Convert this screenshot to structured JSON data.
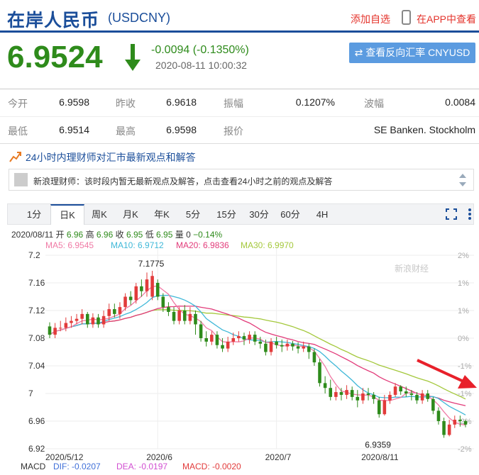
{
  "header": {
    "title": "在岸人民币",
    "code": "(USDCNY)",
    "add_favorite": "添加自选",
    "view_in_app": "在APP中查看"
  },
  "quote": {
    "price": "6.9524",
    "change": "-0.0094 (-0.1350%)",
    "time": "2020-08-11 10:00:32",
    "reverse_button": "查看反向汇率 CNYUSD",
    "price_color": "#2e8b1b",
    "rows": [
      [
        {
          "label": "今开",
          "value": "6.9598"
        },
        {
          "label": "昨收",
          "value": "6.9618"
        },
        {
          "label": "振幅",
          "value": "0.1207%"
        },
        {
          "label": "波幅",
          "value": "0.0084"
        }
      ],
      [
        {
          "label": "最低",
          "value": "6.9514"
        },
        {
          "label": "最高",
          "value": "6.9598"
        },
        {
          "label": "报价",
          "value": ""
        },
        {
          "label": "",
          "value": "SE Banken. Stockholm"
        }
      ]
    ]
  },
  "advisor": {
    "heading": "24小时内理财师对汇市最新观点和解答",
    "message": "新浪理财师：该时段内暂无最新观点及解答，点击查看24小时之前的观点及解答"
  },
  "tabs": [
    "1分",
    "日K",
    "周K",
    "月K",
    "年K",
    "5分",
    "15分",
    "30分",
    "60分",
    "4H"
  ],
  "active_tab": "日K",
  "info": {
    "line1_prefix": "2020/08/11 开",
    "open": "6.96",
    "high_label": "高",
    "high": "6.96",
    "close_label": "收",
    "close": "6.95",
    "low_label": "低",
    "low": "6.95",
    "vol_label": "量",
    "vol": "0",
    "pct": "−0.14%",
    "ma5": "MA5: 6.9545",
    "ma10": "MA10: 6.9712",
    "ma20": "MA20: 6.9836",
    "ma30": "MA30: 6.9970"
  },
  "macd": {
    "label": "MACD",
    "dif": "DIF: -0.0207",
    "dea": "DEA: -0.0197",
    "macd": "MACD: -0.0020"
  },
  "colors": {
    "up": "#e23b3b",
    "down": "#2e8b1b",
    "ma5": "#f07aa5",
    "ma10": "#3fb8d8",
    "ma20": "#e23b7a",
    "ma30": "#a4c83c",
    "brand": "#1b4e9a"
  },
  "chart_data": {
    "type": "candlestick",
    "y_ticks": [
      "7.2",
      "7.16",
      "7.12",
      "7.08",
      "7.04",
      "7",
      "6.96",
      "6.92"
    ],
    "ylim": [
      6.92,
      7.2
    ],
    "pct_ticks": [
      "2%",
      "1%",
      "1%",
      "0%",
      "-1%",
      "-1%",
      "-2%",
      "-2%"
    ],
    "x_labels": [
      "2020/5/12",
      "2020/6",
      "2020/7",
      "2020/8/11"
    ],
    "x_label_index": [
      0,
      20,
      42,
      64
    ],
    "watermark": "新浪财经",
    "annotations": [
      {
        "text": "7.1775",
        "index": 19,
        "value": 7.1775
      },
      {
        "text": "6.9359",
        "index": 61,
        "value": 6.9359
      }
    ],
    "candles": [
      [
        7.097,
        7.085,
        7.103,
        7.08
      ],
      [
        7.085,
        7.095,
        7.102,
        7.08
      ],
      [
        7.095,
        7.095,
        7.105,
        7.09
      ],
      [
        7.095,
        7.102,
        7.11,
        7.09
      ],
      [
        7.102,
        7.105,
        7.112,
        7.095
      ],
      [
        7.105,
        7.108,
        7.115,
        7.1
      ],
      [
        7.108,
        7.115,
        7.122,
        7.1
      ],
      [
        7.115,
        7.1,
        7.118,
        7.095
      ],
      [
        7.1,
        7.11,
        7.116,
        7.095
      ],
      [
        7.11,
        7.1,
        7.115,
        7.095
      ],
      [
        7.1,
        7.112,
        7.12,
        7.095
      ],
      [
        7.112,
        7.122,
        7.13,
        7.105
      ],
      [
        7.122,
        7.115,
        7.13,
        7.11
      ],
      [
        7.115,
        7.125,
        7.132,
        7.108
      ],
      [
        7.125,
        7.14,
        7.145,
        7.12
      ],
      [
        7.14,
        7.135,
        7.148,
        7.128
      ],
      [
        7.135,
        7.155,
        7.16,
        7.13
      ],
      [
        7.155,
        7.148,
        7.165,
        7.14
      ],
      [
        7.148,
        7.165,
        7.175,
        7.14
      ],
      [
        7.14,
        7.17,
        7.1775,
        7.135
      ],
      [
        7.16,
        7.14,
        7.165,
        7.135
      ],
      [
        7.14,
        7.125,
        7.145,
        7.118
      ],
      [
        7.125,
        7.118,
        7.132,
        7.112
      ],
      [
        7.118,
        7.105,
        7.125,
        7.1
      ],
      [
        7.105,
        7.12,
        7.125,
        7.1
      ],
      [
        7.12,
        7.105,
        7.128,
        7.1
      ],
      [
        7.105,
        7.115,
        7.125,
        7.1
      ],
      [
        7.115,
        7.1,
        7.12,
        7.085
      ],
      [
        7.1,
        7.08,
        7.105,
        7.075
      ],
      [
        7.08,
        7.075,
        7.09,
        7.068
      ],
      [
        7.075,
        7.085,
        7.09,
        7.07
      ],
      [
        7.085,
        7.07,
        7.09,
        7.065
      ],
      [
        7.07,
        7.065,
        7.08,
        7.06
      ],
      [
        7.065,
        7.075,
        7.082,
        7.06
      ],
      [
        7.075,
        7.08,
        7.088,
        7.07
      ],
      [
        7.08,
        7.083,
        7.09,
        7.075
      ],
      [
        7.083,
        7.078,
        7.088,
        7.07
      ],
      [
        7.078,
        7.085,
        7.09,
        7.072
      ],
      [
        7.085,
        7.075,
        7.09,
        7.07
      ],
      [
        7.075,
        7.072,
        7.082,
        7.065
      ],
      [
        7.072,
        7.06,
        7.078,
        7.055
      ],
      [
        7.06,
        7.075,
        7.08,
        7.055
      ],
      [
        7.075,
        7.07,
        7.082,
        7.065
      ],
      [
        7.07,
        7.068,
        7.078,
        7.06
      ],
      [
        7.068,
        7.072,
        7.078,
        7.062
      ],
      [
        7.072,
        7.068,
        7.076,
        7.062
      ],
      [
        7.068,
        7.065,
        7.074,
        7.058
      ],
      [
        7.065,
        7.068,
        7.075,
        7.06
      ],
      [
        7.068,
        7.06,
        7.072,
        7.05
      ],
      [
        7.06,
        7.045,
        7.065,
        7.04
      ],
      [
        7.045,
        7.015,
        7.05,
        7.01
      ],
      [
        7.015,
        7.008,
        7.025,
        7.0
      ],
      [
        7.008,
        6.995,
        7.02,
        6.99
      ],
      [
        6.995,
        7.002,
        7.01,
        6.99
      ],
      [
        7.002,
        6.998,
        7.008,
        6.99
      ],
      [
        6.998,
        7.005,
        7.012,
        6.992
      ],
      [
        7.005,
        6.995,
        7.01,
        6.99
      ],
      [
        6.995,
        6.99,
        7.005,
        6.98
      ],
      [
        6.99,
        7.0,
        7.008,
        6.985
      ],
      [
        7.0,
        6.998,
        7.008,
        6.99
      ],
      [
        6.998,
        6.992,
        7.002,
        6.985
      ],
      [
        6.99,
        6.97,
        6.995,
        6.965
      ],
      [
        6.97,
        6.99,
        6.998,
        6.968
      ],
      [
        6.99,
        6.998,
        7.003,
        6.985
      ],
      [
        6.998,
        7.01,
        7.015,
        6.995
      ],
      [
        7.01,
        7.003,
        7.012,
        6.998
      ],
      [
        7.003,
        7.0,
        7.01,
        6.995
      ],
      [
        7.0,
        6.998,
        7.005,
        6.99
      ],
      [
        6.998,
        6.99,
        7.002,
        6.985
      ],
      [
        6.99,
        7.0,
        7.005,
        6.985
      ],
      [
        7.0,
        6.992,
        7.005,
        6.988
      ],
      [
        6.992,
        6.975,
        6.995,
        6.97
      ],
      [
        6.975,
        6.96,
        6.98,
        6.955
      ],
      [
        6.96,
        6.94,
        6.965,
        6.9359
      ],
      [
        6.94,
        6.955,
        6.962,
        6.938
      ],
      [
        6.955,
        6.962,
        6.968,
        6.95
      ],
      [
        6.962,
        6.96,
        6.968,
        6.952
      ],
      [
        6.96,
        6.955,
        6.962,
        6.951
      ]
    ]
  }
}
